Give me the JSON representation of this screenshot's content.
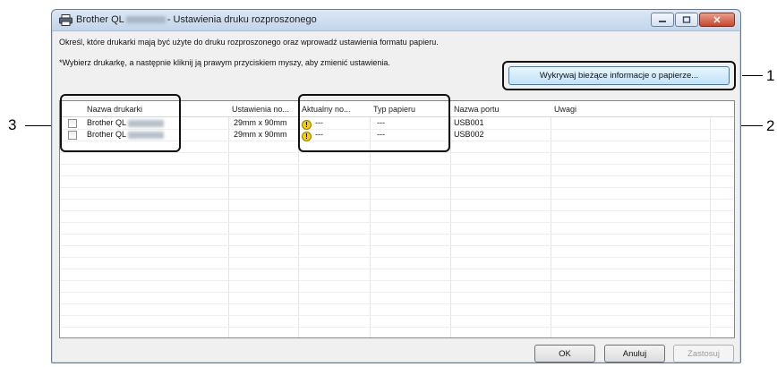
{
  "window": {
    "title_prefix": "Brother QL",
    "title_suffix": "- Ustawienia druku rozproszonego",
    "minimize_icon": "minimize-icon",
    "maximize_icon": "maximize-icon",
    "close_glyph": "✕"
  },
  "instructions": {
    "line1": "Określ, które drukarki mają być użyte do druku rozproszonego oraz wprowadź ustawienia formatu papieru.",
    "line2": "*Wybierz drukarkę, a następnie kliknij ją prawym przyciskiem myszy, aby zmienić ustawienia."
  },
  "detect_button": {
    "label": "Wykrywaj bieżące informacje o papierze..."
  },
  "table": {
    "columns": [
      "Nazwa drukarki",
      "Ustawienia no...",
      "Aktualny no...",
      "Typ papieru",
      "Nazwa portu",
      "Uwagi"
    ],
    "rows": [
      {
        "printer": "Brother QL",
        "settings": "29mm x 90mm",
        "current": "---",
        "paper_type": "---",
        "port": "USB001",
        "notes": "",
        "checked": false,
        "status_icon": "warning-icon"
      },
      {
        "printer": "Brother QL",
        "settings": "29mm x 90mm",
        "current": "---",
        "paper_type": "---",
        "port": "USB002",
        "notes": "",
        "checked": false,
        "status_icon": "warning-icon"
      }
    ]
  },
  "buttons": {
    "ok": "OK",
    "cancel": "Anuluj",
    "apply": "Zastosuj"
  },
  "callouts": [
    "1",
    "2",
    "3"
  ]
}
